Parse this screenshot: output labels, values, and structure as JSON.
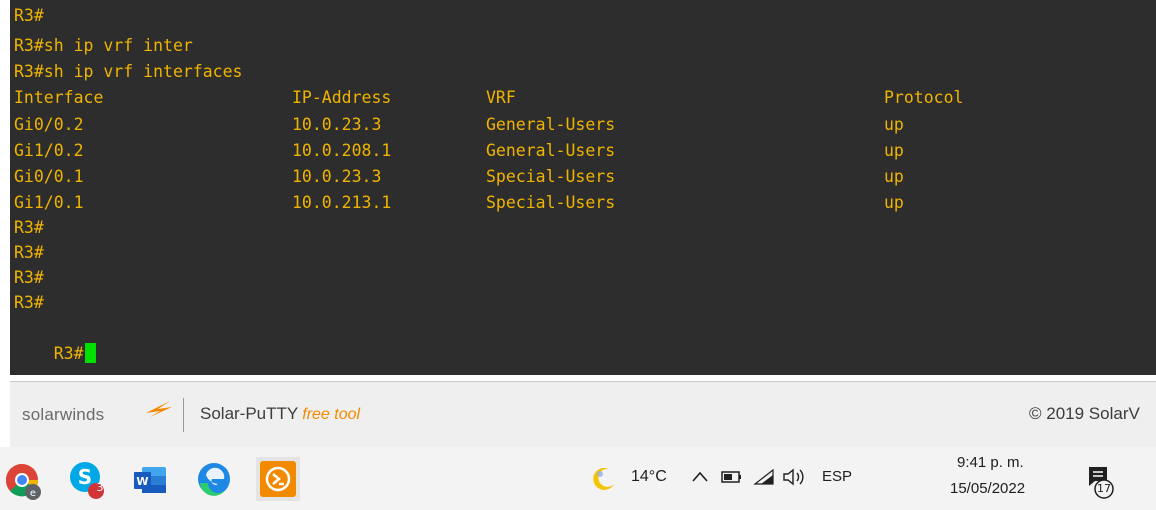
{
  "terminal": {
    "lines": [
      "R3#",
      "R3#sh ip vrf inter",
      "R3#sh ip vrf interfaces"
    ],
    "table_headers": [
      "Interface",
      "IP-Address",
      "VRF",
      "Protocol"
    ],
    "rows": [
      [
        "Gi0/0.2",
        "10.0.23.3",
        "General-Users",
        "up"
      ],
      [
        "Gi1/0.2",
        "10.0.208.1",
        "General-Users",
        "up"
      ],
      [
        "Gi0/0.1",
        "10.0.23.3",
        "Special-Users",
        "up"
      ],
      [
        "Gi1/0.1",
        "10.0.213.1",
        "Special-Users",
        "up"
      ]
    ],
    "trailing_prompts": [
      "R3#",
      "R3#",
      "R3#",
      "R3#"
    ],
    "current_prompt": "R3#",
    "text_color": "#f0b400",
    "cursor_color": "#00e000"
  },
  "footer": {
    "logo_text": "solarwinds",
    "product_name": "Solar-PuTTY",
    "product_tag": "free tool",
    "copyright": "© 2019 SolarV"
  },
  "taskbar": {
    "apps": [
      "chrome-icon",
      "skype-icon",
      "word-icon",
      "edge-icon",
      "solar-putty-icon"
    ],
    "skype_badge": "3",
    "temperature": "14°C",
    "language": "ESP",
    "time": "9:41 p. m.",
    "date": "15/05/2022",
    "notification_count": "17"
  }
}
